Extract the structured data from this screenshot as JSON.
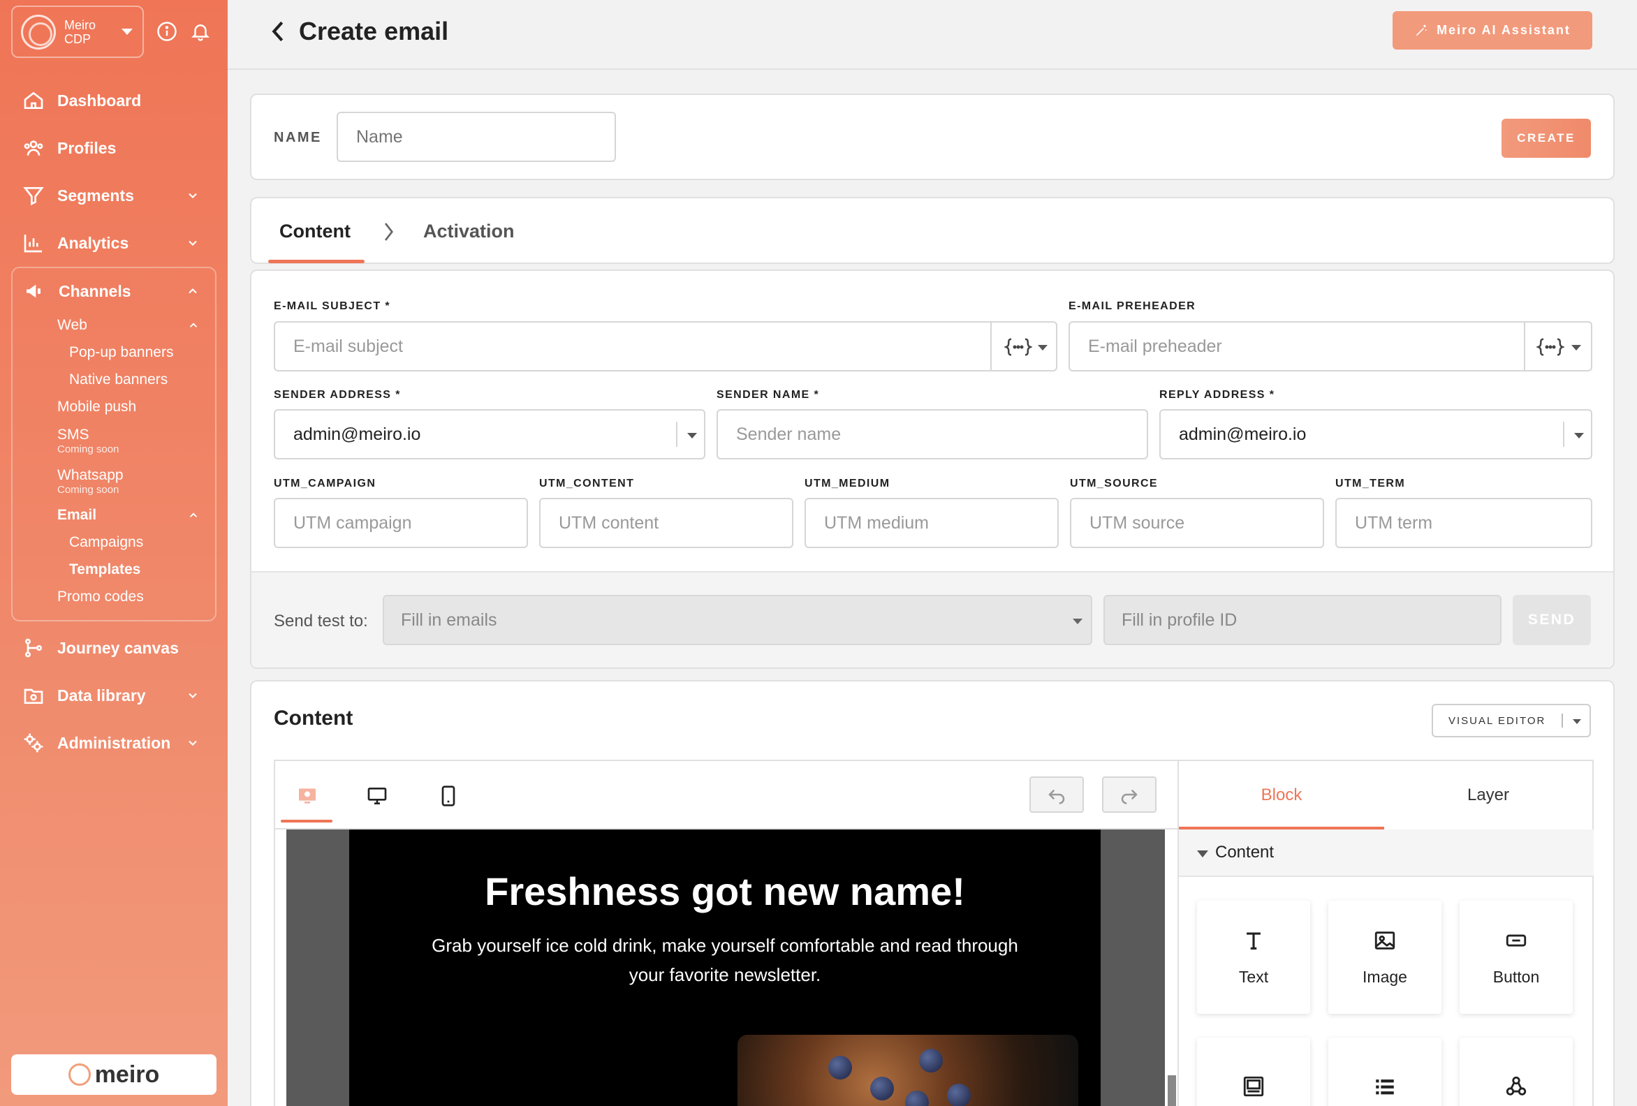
{
  "brand": {
    "name_line1": "Meiro",
    "name_line2": "CDP"
  },
  "sidebar": {
    "items": [
      {
        "label": "Dashboard"
      },
      {
        "label": "Profiles"
      },
      {
        "label": "Segments"
      },
      {
        "label": "Analytics"
      }
    ],
    "channels": {
      "label": "Channels",
      "web": "Web",
      "popup": "Pop-up banners",
      "native": "Native banners",
      "mobile": "Mobile push",
      "sms": "SMS",
      "sms_soon": "Coming soon",
      "whatsapp": "Whatsapp",
      "whatsapp_soon": "Coming soon",
      "email": "Email",
      "campaigns": "Campaigns",
      "templates": "Templates",
      "promo": "Promo codes"
    },
    "bottom_items": [
      {
        "label": "Journey canvas"
      },
      {
        "label": "Data library"
      },
      {
        "label": "Administration"
      }
    ],
    "footer_logo": "meiro"
  },
  "header": {
    "title": "Create email",
    "ai_button": "Meiro AI Assistant"
  },
  "name_card": {
    "label": "NAME",
    "placeholder": "Name",
    "create": "CREATE"
  },
  "tabs": {
    "content": "Content",
    "activation": "Activation"
  },
  "form": {
    "subject_label": "E-MAIL SUBJECT *",
    "subject_placeholder": "E-mail subject",
    "preheader_label": "E-MAIL PREHEADER",
    "preheader_placeholder": "E-mail preheader",
    "sender_address_label": "SENDER ADDRESS *",
    "sender_address_value": "admin@meiro.io",
    "sender_name_label": "SENDER NAME *",
    "sender_name_placeholder": "Sender name",
    "reply_label": "REPLY ADDRESS *",
    "reply_value": "admin@meiro.io",
    "utm_campaign_label": "UTM_CAMPAIGN",
    "utm_campaign_ph": "UTM campaign",
    "utm_content_label": "UTM_CONTENT",
    "utm_content_ph": "UTM content",
    "utm_medium_label": "UTM_MEDIUM",
    "utm_medium_ph": "UTM medium",
    "utm_source_label": "UTM_SOURCE",
    "utm_source_ph": "UTM source",
    "utm_term_label": "UTM_TERM",
    "utm_term_ph": "UTM term",
    "send_test_label": "Send test to:",
    "fill_emails": "Fill in emails",
    "fill_profile": "Fill in profile ID",
    "send": "SEND"
  },
  "content_section": {
    "title": "Content",
    "editor_mode": "VISUAL EDITOR",
    "email_heading": "Freshness got new name!",
    "email_body": "Grab yourself ice cold drink, make yourself comfortable and read through your favorite newsletter.",
    "panel_tabs": {
      "block": "Block",
      "layer": "Layer"
    },
    "panel_section": "Content",
    "blocks": [
      "Text",
      "Image",
      "Button"
    ]
  },
  "colors": {
    "accent": "#ef7556",
    "accent_light": "#f29a7c"
  }
}
